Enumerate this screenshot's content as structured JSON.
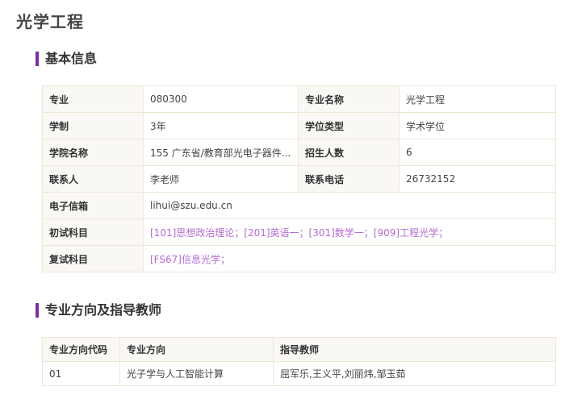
{
  "page": {
    "title": "光学工程"
  },
  "basic_info": {
    "heading": "基本信息",
    "rows": [
      {
        "k1": "专业",
        "v1": "080300",
        "k2": "专业名称",
        "v2": "光学工程"
      },
      {
        "k1": "学制",
        "v1": "3年",
        "k2": "学位类型",
        "v2": "学术学位"
      },
      {
        "k1": "学院名称",
        "v1": "155 广东省/教育部光电子器件...",
        "k2": "招生人数",
        "v2": "6"
      },
      {
        "k1": "联系人",
        "v1": "李老师",
        "k2": "联系电话",
        "v2": "26732152"
      }
    ],
    "email_label": "电子信箱",
    "email_value": "lihui@szu.edu.cn",
    "prelim_label": "初试科目",
    "prelim_value": "[101]思想政治理论；[201]英语一；[301]数学一；[909]工程光学；",
    "retest_label": "复试科目",
    "retest_value": "[FS67]信息光学；"
  },
  "directions": {
    "heading": "专业方向及指导教师",
    "columns": [
      "专业方向代码",
      "专业方向",
      "指导教师"
    ],
    "rows": [
      {
        "code": "01",
        "name": "光子学与人工智能计算",
        "teachers": "屈军乐,王义平,刘丽炜,邹玉茹"
      }
    ]
  },
  "colors": {
    "accent": "#7b2fa5",
    "link": "#b46bd0",
    "border": "#efe6d6",
    "label_bg": "#faf8f5"
  }
}
